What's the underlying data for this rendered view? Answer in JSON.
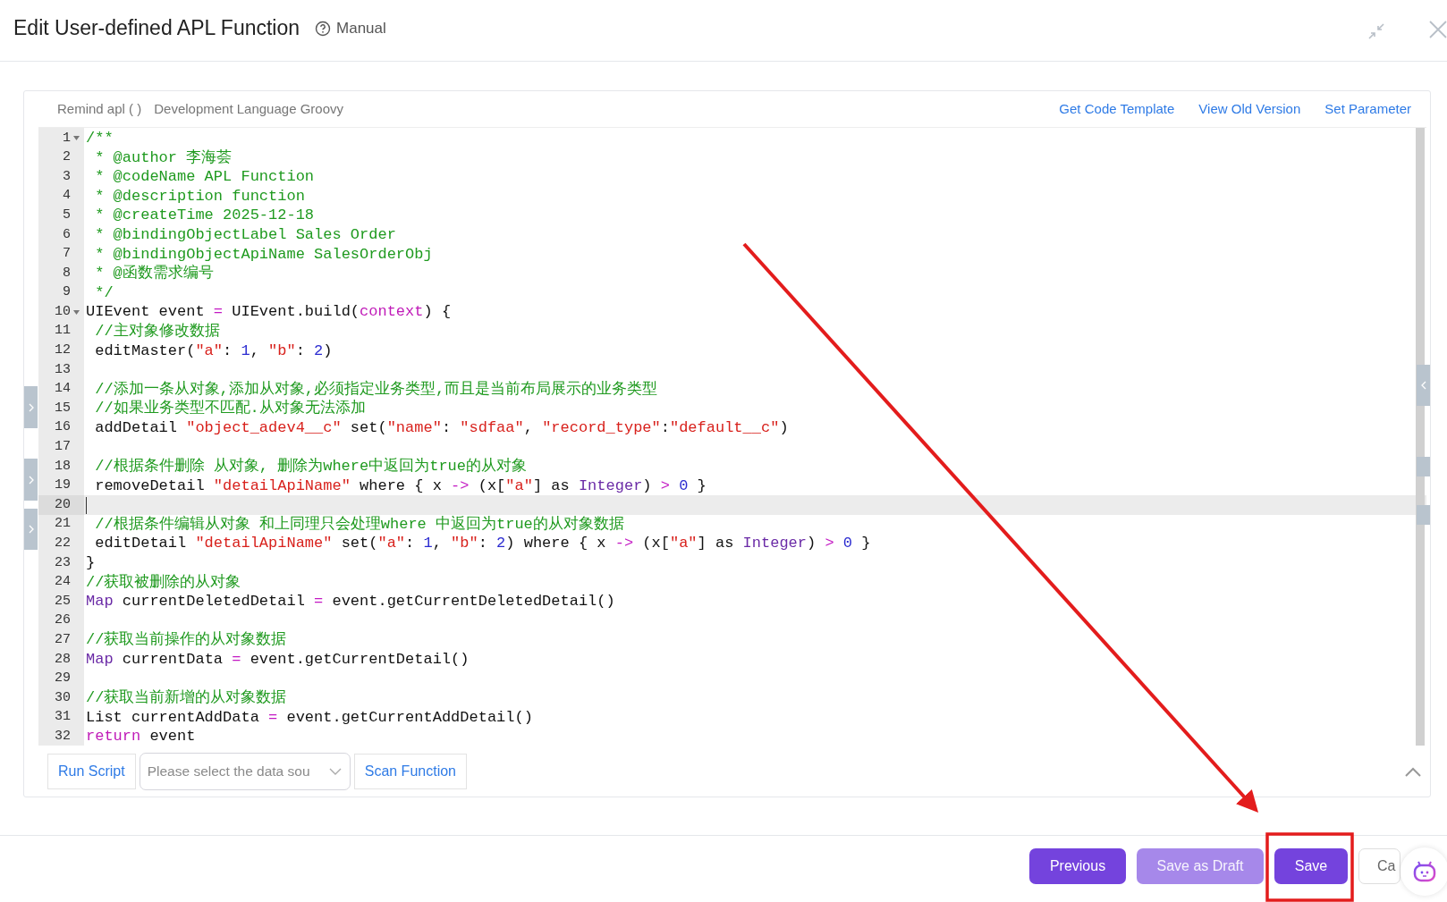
{
  "dialog": {
    "title": "Edit User-defined APL Function",
    "help_link": "Manual"
  },
  "editor_header": {
    "info": [
      "Remind apl ( )",
      "Development Language Groovy"
    ],
    "links": [
      "Get Code Template",
      "View Old Version",
      "Set Parameter"
    ]
  },
  "code": {
    "lines": [
      {
        "number": "1",
        "foldable": true,
        "active": false,
        "tokens": [
          {
            "kind": "comment",
            "text": "/**"
          }
        ]
      },
      {
        "number": "2",
        "foldable": false,
        "active": false,
        "tokens": [
          {
            "kind": "comment",
            "text": " * @author 李海荟"
          }
        ]
      },
      {
        "number": "3",
        "foldable": false,
        "active": false,
        "tokens": [
          {
            "kind": "comment",
            "text": " * @codeName APL Function"
          }
        ]
      },
      {
        "number": "4",
        "foldable": false,
        "active": false,
        "tokens": [
          {
            "kind": "comment",
            "text": " * @description function"
          }
        ]
      },
      {
        "number": "5",
        "foldable": false,
        "active": false,
        "tokens": [
          {
            "kind": "comment",
            "text": " * @createTime 2025-12-18"
          }
        ]
      },
      {
        "number": "6",
        "foldable": false,
        "active": false,
        "tokens": [
          {
            "kind": "comment",
            "text": " * @bindingObjectLabel Sales Order"
          }
        ]
      },
      {
        "number": "7",
        "foldable": false,
        "active": false,
        "tokens": [
          {
            "kind": "comment",
            "text": " * @bindingObjectApiName SalesOrderObj"
          }
        ]
      },
      {
        "number": "8",
        "foldable": false,
        "active": false,
        "tokens": [
          {
            "kind": "comment",
            "text": " * @函数需求编号"
          }
        ]
      },
      {
        "number": "9",
        "foldable": false,
        "active": false,
        "tokens": [
          {
            "kind": "comment",
            "text": " */"
          }
        ]
      },
      {
        "number": "10",
        "foldable": true,
        "active": false,
        "tokens": [
          {
            "kind": "plain",
            "text": "UIEvent event "
          },
          {
            "kind": "operator",
            "text": "="
          },
          {
            "kind": "plain",
            "text": " UIEvent.build("
          },
          {
            "kind": "keyword",
            "text": "context"
          },
          {
            "kind": "plain",
            "text": ") {"
          }
        ]
      },
      {
        "number": "11",
        "foldable": false,
        "active": false,
        "tokens": [
          {
            "kind": "comment",
            "text": " //主对象修改数据"
          }
        ]
      },
      {
        "number": "12",
        "foldable": false,
        "active": false,
        "tokens": [
          {
            "kind": "plain",
            "text": " editMaster("
          },
          {
            "kind": "string",
            "text": "\"a\""
          },
          {
            "kind": "plain",
            "text": ": "
          },
          {
            "kind": "number",
            "text": "1"
          },
          {
            "kind": "plain",
            "text": ", "
          },
          {
            "kind": "string",
            "text": "\"b\""
          },
          {
            "kind": "plain",
            "text": ": "
          },
          {
            "kind": "number",
            "text": "2"
          },
          {
            "kind": "plain",
            "text": ")"
          }
        ]
      },
      {
        "number": "13",
        "foldable": false,
        "active": false
      },
      {
        "number": "14",
        "foldable": false,
        "active": false,
        "tokens": [
          {
            "kind": "comment",
            "text": " //添加一条从对象,添加从对象,必须指定业务类型,而且是当前布局展示的业务类型"
          }
        ]
      },
      {
        "number": "15",
        "foldable": false,
        "active": false,
        "tokens": [
          {
            "kind": "comment",
            "text": " //如果业务类型不匹配.从对象无法添加"
          }
        ]
      },
      {
        "number": "16",
        "foldable": false,
        "active": false,
        "tokens": [
          {
            "kind": "plain",
            "text": " addDetail "
          },
          {
            "kind": "string",
            "text": "\"object_adev4__c\""
          },
          {
            "kind": "plain",
            "text": " set("
          },
          {
            "kind": "string",
            "text": "\"name\""
          },
          {
            "kind": "plain",
            "text": ": "
          },
          {
            "kind": "string",
            "text": "\"sdfaa\""
          },
          {
            "kind": "plain",
            "text": ", "
          },
          {
            "kind": "string",
            "text": "\"record_type\""
          },
          {
            "kind": "plain",
            "text": ":"
          },
          {
            "kind": "string",
            "text": "\"default__c\""
          },
          {
            "kind": "plain",
            "text": ")"
          }
        ]
      },
      {
        "number": "17",
        "foldable": false,
        "active": false
      },
      {
        "number": "18",
        "foldable": false,
        "active": false,
        "tokens": [
          {
            "kind": "comment",
            "text": " //根据条件删除 从对象, 删除为where中返回为true的从对象"
          }
        ]
      },
      {
        "number": "19",
        "foldable": false,
        "active": false,
        "tokens": [
          {
            "kind": "plain",
            "text": " removeDetail "
          },
          {
            "kind": "string",
            "text": "\"detailApiName\""
          },
          {
            "kind": "plain",
            "text": " where { x "
          },
          {
            "kind": "operator",
            "text": "->"
          },
          {
            "kind": "plain",
            "text": " (x["
          },
          {
            "kind": "string",
            "text": "\"a\""
          },
          {
            "kind": "plain",
            "text": "] as "
          },
          {
            "kind": "type",
            "text": "Integer"
          },
          {
            "kind": "plain",
            "text": ") "
          },
          {
            "kind": "operator",
            "text": "> "
          },
          {
            "kind": "number",
            "text": "0"
          },
          {
            "kind": "plain",
            "text": " }"
          }
        ]
      },
      {
        "number": "20",
        "foldable": false,
        "active": true
      },
      {
        "number": "21",
        "foldable": false,
        "active": false,
        "tokens": [
          {
            "kind": "comment",
            "text": " //根据条件编辑从对象 和上同理只会处理where 中返回为true的从对象数据"
          }
        ]
      },
      {
        "number": "22",
        "foldable": false,
        "active": false,
        "tokens": [
          {
            "kind": "plain",
            "text": " editDetail "
          },
          {
            "kind": "string",
            "text": "\"detailApiName\""
          },
          {
            "kind": "plain",
            "text": " set("
          },
          {
            "kind": "string",
            "text": "\"a\""
          },
          {
            "kind": "plain",
            "text": ": "
          },
          {
            "kind": "number",
            "text": "1"
          },
          {
            "kind": "plain",
            "text": ", "
          },
          {
            "kind": "string",
            "text": "\"b\""
          },
          {
            "kind": "plain",
            "text": ": "
          },
          {
            "kind": "number",
            "text": "2"
          },
          {
            "kind": "plain",
            "text": ") where { x "
          },
          {
            "kind": "operator",
            "text": "->"
          },
          {
            "kind": "plain",
            "text": " (x["
          },
          {
            "kind": "string",
            "text": "\"a\""
          },
          {
            "kind": "plain",
            "text": "] as "
          },
          {
            "kind": "type",
            "text": "Integer"
          },
          {
            "kind": "plain",
            "text": ") "
          },
          {
            "kind": "operator",
            "text": "> "
          },
          {
            "kind": "number",
            "text": "0"
          },
          {
            "kind": "plain",
            "text": " }"
          }
        ]
      },
      {
        "number": "23",
        "foldable": false,
        "active": false,
        "tokens": [
          {
            "kind": "plain",
            "text": "}"
          }
        ]
      },
      {
        "number": "24",
        "foldable": false,
        "active": false,
        "tokens": [
          {
            "kind": "comment",
            "text": "//获取被删除的从对象"
          }
        ]
      },
      {
        "number": "25",
        "foldable": false,
        "active": false,
        "tokens": [
          {
            "kind": "type",
            "text": "Map"
          },
          {
            "kind": "plain",
            "text": " currentDeletedDetail "
          },
          {
            "kind": "operator",
            "text": "="
          },
          {
            "kind": "plain",
            "text": " event.getCurrentDeletedDetail()"
          }
        ]
      },
      {
        "number": "26",
        "foldable": false,
        "active": false
      },
      {
        "number": "27",
        "foldable": false,
        "active": false,
        "tokens": [
          {
            "kind": "comment",
            "text": "//获取当前操作的从对象数据"
          }
        ]
      },
      {
        "number": "28",
        "foldable": false,
        "active": false,
        "tokens": [
          {
            "kind": "type",
            "text": "Map"
          },
          {
            "kind": "plain",
            "text": " currentData "
          },
          {
            "kind": "operator",
            "text": "="
          },
          {
            "kind": "plain",
            "text": " event.getCurrentDetail()"
          }
        ]
      },
      {
        "number": "29",
        "foldable": false,
        "active": false
      },
      {
        "number": "30",
        "foldable": false,
        "active": false,
        "tokens": [
          {
            "kind": "comment",
            "text": "//获取当前新增的从对象数据"
          }
        ]
      },
      {
        "number": "31",
        "foldable": false,
        "active": false,
        "tokens": [
          {
            "kind": "plain",
            "text": "List currentAddData "
          },
          {
            "kind": "operator",
            "text": "="
          },
          {
            "kind": "plain",
            "text": " event.getCurrentAddDetail()"
          }
        ]
      },
      {
        "number": "32",
        "foldable": false,
        "active": false,
        "tokens": [
          {
            "kind": "keyword",
            "text": "return"
          },
          {
            "kind": "plain",
            "text": " event"
          }
        ]
      }
    ]
  },
  "toolbar": {
    "run_button": "Run Script",
    "data_source": {
      "placeholder": "Please select the data sou"
    },
    "scan_button": "Scan Function"
  },
  "footer": {
    "buttons": [
      {
        "label": "Previous",
        "kind": "primary",
        "disabled": false
      },
      {
        "label": "Save as Draft",
        "kind": "primary",
        "disabled": true
      },
      {
        "label": "Save",
        "kind": "primary",
        "disabled": false
      },
      {
        "label": "Ca",
        "kind": "default",
        "disabled": false
      }
    ]
  }
}
